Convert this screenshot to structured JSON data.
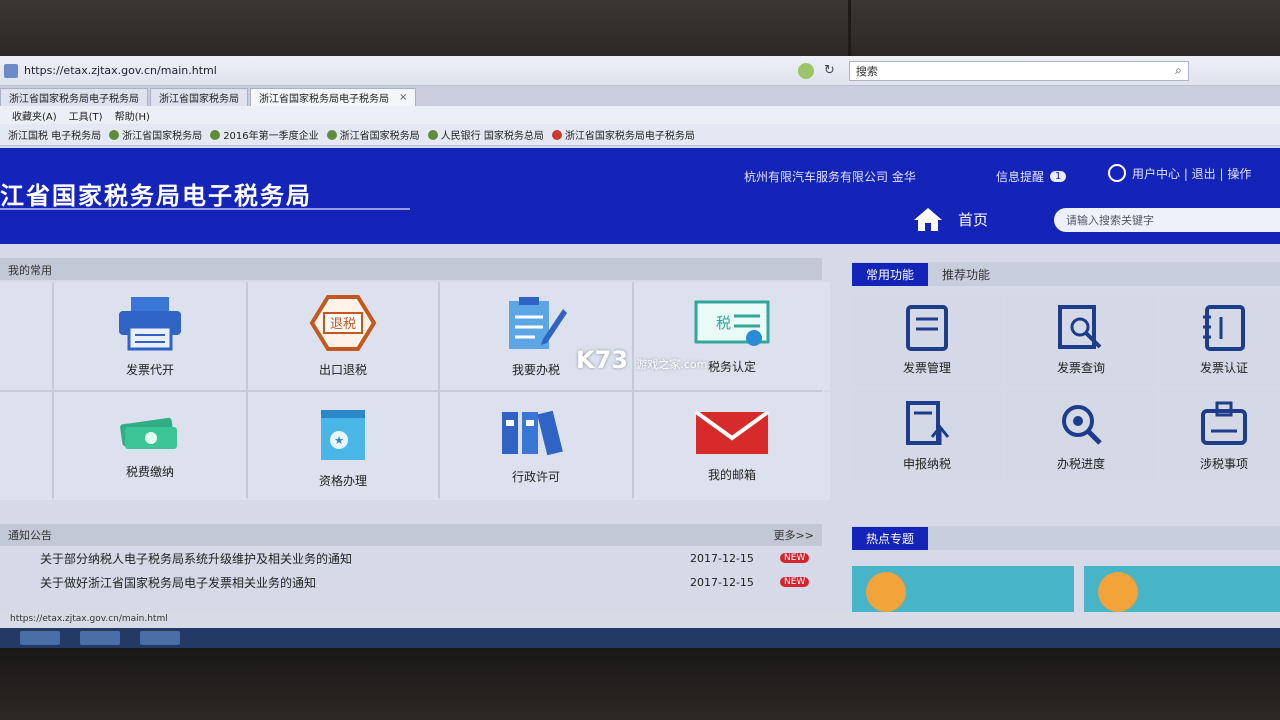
{
  "browser": {
    "url": "https://etax.zjtax.gov.cn/main.html",
    "search_placeholder": "搜索",
    "tabs": [
      "浙江省国家税务局电子税务局",
      "浙江省国家税务局",
      "浙江省国家税务局电子税务局"
    ],
    "menu": [
      "收藏夹(A)",
      "工具(T)",
      "帮助(H)"
    ],
    "favorites": [
      "浙江国税 电子税务局",
      "浙江省国家税务局",
      "2016年第一季度企业",
      "浙江省国家税务局",
      "人民银行 国家税务总局",
      "浙江省国家税务局电子税务局"
    ],
    "status_url": "https://etax.zjtax.gov.cn/main.html"
  },
  "header": {
    "title": "江省国家税务局电子税务局",
    "company": "杭州有限汽车服务有限公司 金华",
    "messages_label": "信息提醒",
    "messages_count": "1",
    "user_center": "用户中心 | 退出 | 操作",
    "home_label": "首页",
    "search_placeholder": "请输入搜索关键字"
  },
  "common": {
    "section_label": "我的常用",
    "items": [
      {
        "label": "发票代开",
        "icon": "printer-icon"
      },
      {
        "label": "出口退税",
        "icon": "tax-refund-icon"
      },
      {
        "label": "我要办税",
        "icon": "form-edit-icon"
      },
      {
        "label": "税务认定",
        "icon": "tax-certificate-icon"
      },
      {
        "label": "税费缴纳",
        "icon": "money-icon"
      },
      {
        "label": "资格办理",
        "icon": "certificate-book-icon"
      },
      {
        "label": "行政许可",
        "icon": "binders-icon"
      },
      {
        "label": "我的邮箱",
        "icon": "mail-icon"
      }
    ]
  },
  "right": {
    "tabs": [
      "常用功能",
      "推荐功能"
    ],
    "items": [
      {
        "label": "发票管理",
        "icon": "invoice-icon"
      },
      {
        "label": "发票查询",
        "icon": "search-doc-icon"
      },
      {
        "label": "发票认证",
        "icon": "notebook-icon"
      },
      {
        "label": "申报纳税",
        "icon": "upload-doc-icon"
      },
      {
        "label": "办税进度",
        "icon": "magnifier-icon"
      },
      {
        "label": "涉税事项",
        "icon": "badge-icon"
      }
    ]
  },
  "notices": {
    "section_label": "通知公告",
    "more_label": "更多>>",
    "rows": [
      {
        "title": "关于部分纳税人电子税务局系统升级维护及相关业务的通知",
        "date": "2017-12-15",
        "badge": "NEW"
      },
      {
        "title": "关于做好浙江省国家税务局电子发票相关业务的通知",
        "date": "2017-12-15",
        "badge": "NEW"
      }
    ]
  },
  "hot": {
    "label": "热点专题"
  },
  "watermark": {
    "brand": "K73",
    "sub": "游戏之家",
    "domain": ".com"
  },
  "colors": {
    "header_blue": "#1424b8",
    "badge_red": "#d6232e"
  }
}
